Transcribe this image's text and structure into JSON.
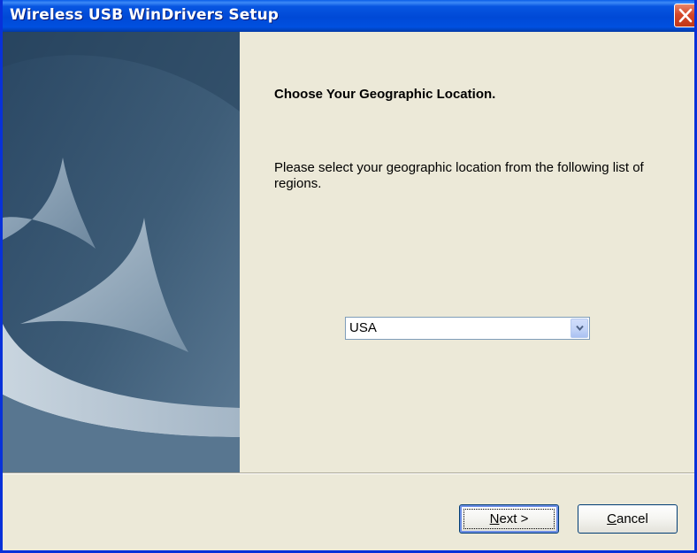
{
  "window": {
    "title": "Wireless USB WinDrivers Setup"
  },
  "content": {
    "heading": "Choose Your Geographic Location.",
    "description": "Please select your geographic location from the following list of regions."
  },
  "region_select": {
    "selected_value": "USA"
  },
  "buttons": {
    "next_mnemonic": "N",
    "next_rest": "ext >",
    "cancel_mnemonic": "C",
    "cancel_rest": "ancel"
  },
  "colors": {
    "title_bar": "#0054e3",
    "close_button": "#d5482a",
    "dialog_background": "#ece9d8",
    "banner_background": "#3f5e78"
  },
  "icons": {
    "close": "close-icon",
    "dropdown": "chevron-down-icon"
  }
}
